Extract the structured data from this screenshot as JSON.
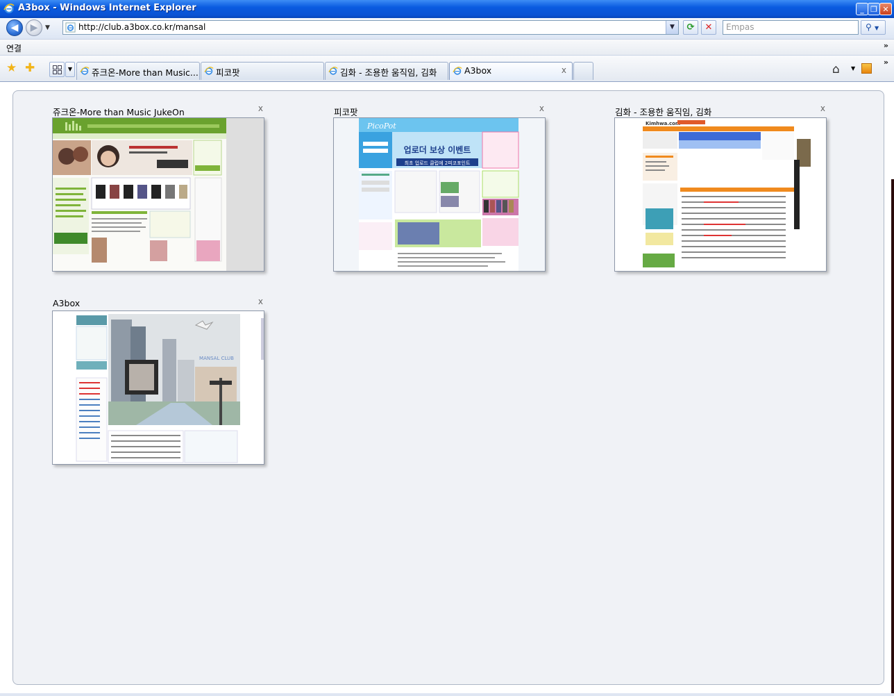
{
  "window": {
    "title": "A3box - Windows Internet Explorer",
    "controls": [
      "minimize",
      "restore",
      "close"
    ]
  },
  "address_bar": {
    "url": "http://club.a3box.co.kr/mansal",
    "search_placeholder": "Empas"
  },
  "links_bar": {
    "label": "연결",
    "overflow": "»"
  },
  "tabs": [
    {
      "label": "쥬크온-More than Music..."
    },
    {
      "label": "피코팟"
    },
    {
      "label": "김화 - 조용한 움직임, 김화"
    },
    {
      "label": "A3box",
      "active": true,
      "close": "x"
    }
  ],
  "quick_tabs": [
    {
      "title": "쥬크온-More than Music JukeOn",
      "close": "x"
    },
    {
      "title": "피코팟",
      "close": "x"
    },
    {
      "title": "김화 - 조용한 움직임, 김화",
      "close": "x"
    },
    {
      "title": "A3box",
      "close": "x"
    }
  ],
  "thumb_text": {
    "picopot_banner": "업로더 보상 이벤트",
    "picopot_sub": "최초 업로드 클럽에 2피코포인트",
    "picopot_logo": "PicoPot",
    "kimhwa_logo": "Kimhwa.com",
    "a3box_logo": "MANSAL CLUB"
  },
  "colors": {
    "titlebar": "#0a52d3",
    "panel": "#f0f2f6",
    "jukeon_green": "#7fb43a",
    "picopot_blue": "#3aa2e0",
    "kimhwa_orange": "#f08a1e"
  }
}
